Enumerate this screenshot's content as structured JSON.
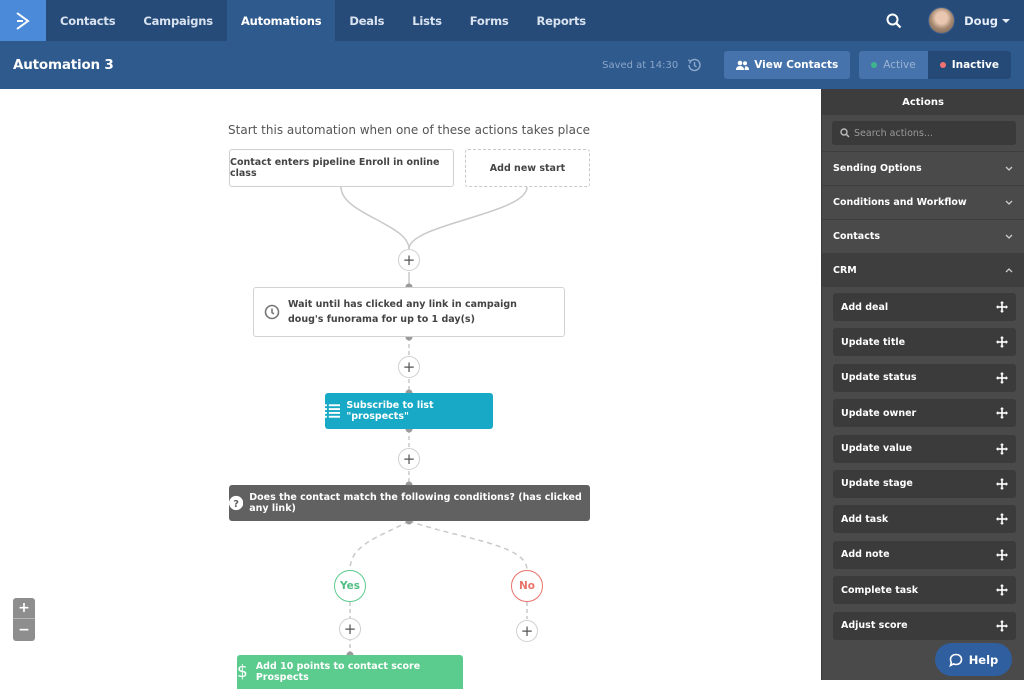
{
  "topnav": {
    "logo": "activecampaign-logo",
    "items": [
      {
        "label": "Contacts",
        "active": false
      },
      {
        "label": "Campaigns",
        "active": false
      },
      {
        "label": "Automations",
        "active": true
      },
      {
        "label": "Deals",
        "active": false
      },
      {
        "label": "Lists",
        "active": false
      },
      {
        "label": "Forms",
        "active": false
      },
      {
        "label": "Reports",
        "active": false
      }
    ],
    "user_name": "Doug"
  },
  "subheader": {
    "title": "Automation 3",
    "saved_text": "Saved at 14:30",
    "view_contacts_label": "View Contacts",
    "status_options": {
      "active_label": "Active",
      "inactive_label": "Inactive",
      "selected": "Inactive"
    },
    "colors": {
      "active_dot": "#3fb58f",
      "inactive_dot": "#f27171"
    }
  },
  "workflow": {
    "start_title": "Start this automation when one of these actions takes place",
    "trigger": "Contact enters pipeline Enroll in online class",
    "add_start": "Add new start",
    "wait_step": "Wait until has clicked any link in campaign doug's funorama for up to 1 day(s)",
    "subscribe_step": "Subscribe to list \"prospects\"",
    "condition_step": "Does the contact match the following conditions? (has clicked any link)",
    "yes_label": "Yes",
    "no_label": "No",
    "score_step": "Add 10 points to contact score Prospects",
    "plus_symbol": "+",
    "colors": {
      "subscribe": "#18a9c6",
      "condition": "#616161",
      "score": "#5ccb8e",
      "yes": "#5ccb8e",
      "no": "#e8736a"
    }
  },
  "zoom_controls": {
    "zoom_in": "+",
    "zoom_out": "−"
  },
  "sidebar": {
    "title": "Actions",
    "search_placeholder": "Search actions...",
    "sections": [
      {
        "label": "Sending Options",
        "expanded": false
      },
      {
        "label": "Conditions and Workflow",
        "expanded": false
      },
      {
        "label": "Contacts",
        "expanded": false
      },
      {
        "label": "CRM",
        "expanded": true
      }
    ],
    "crm_items": [
      "Add deal",
      "Update title",
      "Update status",
      "Update owner",
      "Update value",
      "Update stage",
      "Add task",
      "Add note",
      "Complete task",
      "Adjust score"
    ]
  },
  "help": {
    "label": "Help"
  }
}
